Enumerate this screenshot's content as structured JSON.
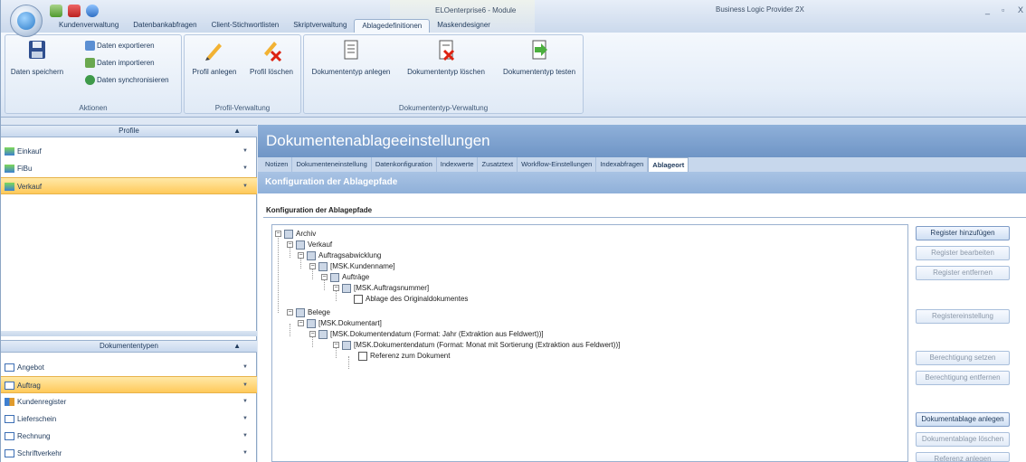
{
  "app": {
    "window_title": "ELOenterprise6 - Module",
    "context_title": "Business Logic Provider 2X",
    "window_controls": [
      "_",
      "▫",
      "X"
    ]
  },
  "ribbon": {
    "tabs": [
      "Kundenverwaltung",
      "Datenbankabfragen",
      "Client-Stichwortlisten",
      "Skriptverwaltung",
      "Ablagedefinitionen",
      "Maskendesigner"
    ],
    "active_tab": "Ablagedefinitionen",
    "groups": {
      "aktionen": {
        "label": "Aktionen",
        "save_label": "Daten speichern",
        "export_label": "Daten exportieren",
        "import_label": "Daten importieren",
        "sync_label": "Daten synchronisieren"
      },
      "profil": {
        "label": "Profil-Verwaltung",
        "create_label": "Profil anlegen",
        "delete_label": "Profil löschen"
      },
      "doktyp": {
        "label": "Dokumententyp-Verwaltung",
        "create_label": "Dokumententyp anlegen",
        "delete_label": "Dokumententyp löschen",
        "test_label": "Dokumententyp testen"
      }
    }
  },
  "profiles": {
    "header": "Profile",
    "items": [
      "Einkauf",
      "FiBu",
      "Verkauf"
    ],
    "selected": "Verkauf"
  },
  "doctypes": {
    "header": "Dokumententypen",
    "items": [
      "Angebot",
      "Auftrag",
      "Kundenregister",
      "Lieferschein",
      "Rechnung",
      "Schriftverkehr"
    ],
    "selected": "Auftrag"
  },
  "main": {
    "title": "Dokumentenablageeinstellungen",
    "tabs": [
      "Notizen",
      "Dokumenteneinstellung",
      "Datenkonfiguration",
      "Indexwerte",
      "Zusatztext",
      "Workflow-Einstellungen",
      "Indexabfragen",
      "Ablageort"
    ],
    "active_tab": "Ablageort",
    "section_header": "Konfiguration der Ablagepfade",
    "group_label": "Konfiguration der Ablagepfade"
  },
  "tree": {
    "archiv": "Archiv",
    "verkauf": "Verkauf",
    "auftragsabwicklung": "Auftragsabwicklung",
    "kundenname": "[MSK.Kundenname]",
    "auftraege": "Aufträge",
    "auftragsnummer": "[MSK.Auftragsnummer]",
    "ablage": "Ablage des Originaldokumentes",
    "belege": "Belege",
    "dokumentart": "[MSK.Dokumentart]",
    "datum_jahr": "[MSK.Dokumentendatum (Format: Jahr (Extraktion aus Feldwert))]",
    "datum_monat": "[MSK.Dokumentendatum (Format: Monat mit Sortierung (Extraktion aus Feldwert))]",
    "referenz": "Referenz zum Dokument"
  },
  "buttons": {
    "register_add": "Register hinzufügen",
    "register_edit": "Register bearbeiten",
    "register_remove": "Register entfernen",
    "register_settings": "Registereinstellung",
    "perm_set": "Berechtigung setzen",
    "perm_remove": "Berechtigung entfernen",
    "ablage_create": "Dokumentablage anlegen",
    "ablage_delete": "Dokumentablage löschen",
    "ref_create": "Referenz anlegen"
  },
  "colors": {
    "ribbon_bg": "#e4edf8",
    "header_blue": "#7fa2cf",
    "selection_orange": "#ffc95a"
  }
}
